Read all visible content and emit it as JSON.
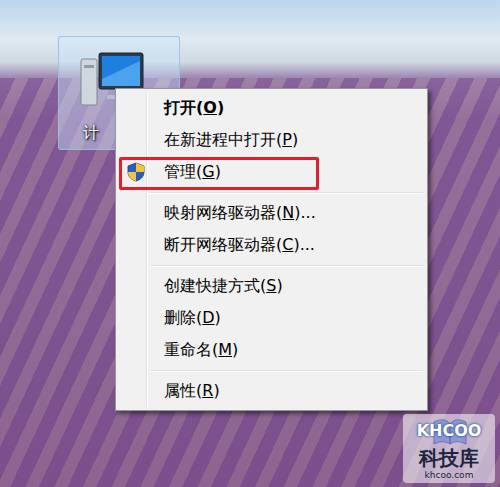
{
  "desktop_icon": {
    "label": "计",
    "selected": true
  },
  "menu": {
    "items": [
      {
        "kind": "item",
        "parts": [
          "打开(",
          "O",
          ")"
        ],
        "default": true,
        "annotated": false
      },
      {
        "kind": "item",
        "parts": [
          "在新进程中打开(",
          "P",
          ")"
        ],
        "default": false,
        "annotated": false
      },
      {
        "kind": "uac-item",
        "parts": [
          "管理(",
          "G",
          ")"
        ],
        "default": false,
        "annotated": true
      },
      {
        "kind": "separator",
        "parts": [],
        "default": false,
        "annotated": false
      },
      {
        "kind": "item",
        "parts": [
          "映射网络驱动器(",
          "N",
          ")..."
        ],
        "default": false,
        "annotated": false
      },
      {
        "kind": "item",
        "parts": [
          "断开网络驱动器(",
          "C",
          ")..."
        ],
        "default": false,
        "annotated": false
      },
      {
        "kind": "separator",
        "parts": [],
        "default": false,
        "annotated": false
      },
      {
        "kind": "item",
        "parts": [
          "创建快捷方式(",
          "S",
          ")"
        ],
        "default": false,
        "annotated": false
      },
      {
        "kind": "item",
        "parts": [
          "删除(",
          "D",
          ")"
        ],
        "default": false,
        "annotated": false
      },
      {
        "kind": "item",
        "parts": [
          "重命名(",
          "M",
          ")"
        ],
        "default": false,
        "annotated": false
      },
      {
        "kind": "separator",
        "parts": [],
        "default": false,
        "annotated": false
      },
      {
        "kind": "item",
        "parts": [
          "属性(",
          "R",
          ")"
        ],
        "default": false,
        "annotated": false
      }
    ]
  },
  "watermark": {
    "brand": "KHCOO",
    "name": "科技库",
    "site": "khcoo.com"
  }
}
